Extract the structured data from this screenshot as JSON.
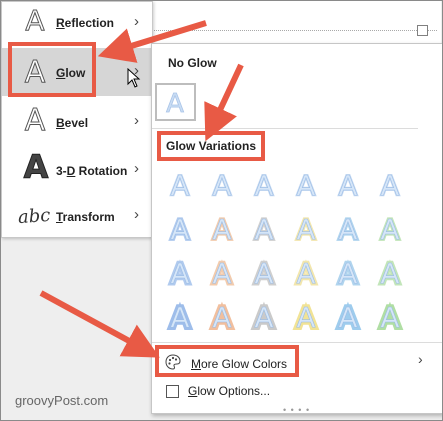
{
  "colors": {
    "highlight": "#e85a45",
    "selected_bg": "#d6d6d6",
    "glow_blue": "#9fbfe7"
  },
  "left_menu": {
    "items": [
      {
        "label_pre": "",
        "label_u": "R",
        "label_post": "eflection",
        "icon": "reflection-icon"
      },
      {
        "label_pre": "",
        "label_u": "G",
        "label_post": "low",
        "icon": "glow-icon",
        "active": true
      },
      {
        "label_pre": "",
        "label_u": "B",
        "label_post": "evel",
        "icon": "bevel-icon"
      },
      {
        "label_pre": "3-",
        "label_u": "D",
        "label_post": " Rotation",
        "icon": "3d-rotation-icon"
      },
      {
        "label_pre": "",
        "label_u": "T",
        "label_post": "ransform",
        "icon": "transform-icon"
      }
    ]
  },
  "gallery": {
    "no_glow_header": "No Glow",
    "glow_variations_header": "Glow Variations",
    "rows": [
      {
        "colors": [
          "#9fbfe7",
          "#9fbfe7",
          "#9fbfe7",
          "#9fbfe7",
          "#9fbfe7",
          "#9fbfe7"
        ]
      },
      {
        "colors": [
          "#6f9fe0",
          "#e8a06a",
          "#a8a8a8",
          "#e8d16a",
          "#6fb0e0",
          "#8fcf7f"
        ]
      },
      {
        "colors": [
          "#6f9fe0",
          "#e8a06a",
          "#a8a8a8",
          "#e8d16a",
          "#6fb0e0",
          "#8fcf7f"
        ]
      },
      {
        "colors": [
          "#4f86d8",
          "#e58a4e",
          "#9e9e9e",
          "#e6cc40",
          "#4fa2de",
          "#6fc25a"
        ]
      }
    ],
    "more_glow_colors_pre": "",
    "more_glow_colors_u": "M",
    "more_glow_colors_post": "ore Glow Colors",
    "glow_options_pre": "",
    "glow_options_u": "G",
    "glow_options_post": "low Options..."
  },
  "watermark": "groovyPost.com"
}
